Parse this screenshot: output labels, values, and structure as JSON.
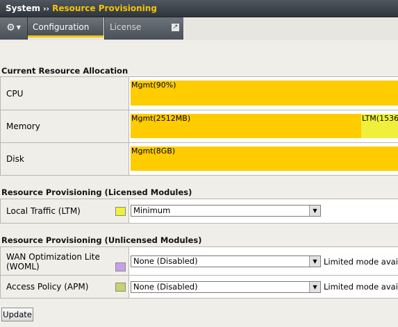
{
  "breadcrumb": {
    "root": "System",
    "separator": "››",
    "current": "Resource Provisioning"
  },
  "tabs": {
    "menu_icon": "gear-icon",
    "configuration": "Configuration",
    "license": "License",
    "external_icon": "external-link-icon"
  },
  "allocation": {
    "title": "Current Resource Allocation",
    "rows": [
      {
        "label": "CPU",
        "segments": [
          {
            "text": "Mgmt(90%)",
            "module": "Mgmt",
            "fraction": 1.0
          }
        ]
      },
      {
        "label": "Memory",
        "segments": [
          {
            "text": "Mgmt(2512MB)",
            "module": "Mgmt",
            "fraction": 0.86
          },
          {
            "text": "LTM(1536",
            "module": "LTM",
            "fraction": 0.14
          }
        ]
      },
      {
        "label": "Disk",
        "segments": [
          {
            "text": "Mgmt(8GB)",
            "module": "Mgmt",
            "fraction": 1.0
          }
        ]
      }
    ]
  },
  "licensed": {
    "title": "Resource Provisioning (Licensed Modules)",
    "modules": [
      {
        "label": "Local Traffic (LTM)",
        "swatch_color": "#f0f03c",
        "selected": "Minimum"
      }
    ]
  },
  "unlicensed": {
    "title": "Resource Provisioning (Unlicensed Modules)",
    "modules": [
      {
        "label": "WAN Optimization Lite (WOML)",
        "swatch_color": "#c8a0e8",
        "selected": "None (Disabled)",
        "note": "Limited mode availa"
      },
      {
        "label": "Access Policy (APM)",
        "swatch_color": "#c8d26e",
        "selected": "None (Disabled)",
        "note": "Limited mode availa"
      }
    ]
  },
  "actions": {
    "update": "Update"
  },
  "colors": {
    "mgmt": "#ffcc00",
    "ltm": "#f0f03c",
    "accent": "#f5c400"
  }
}
